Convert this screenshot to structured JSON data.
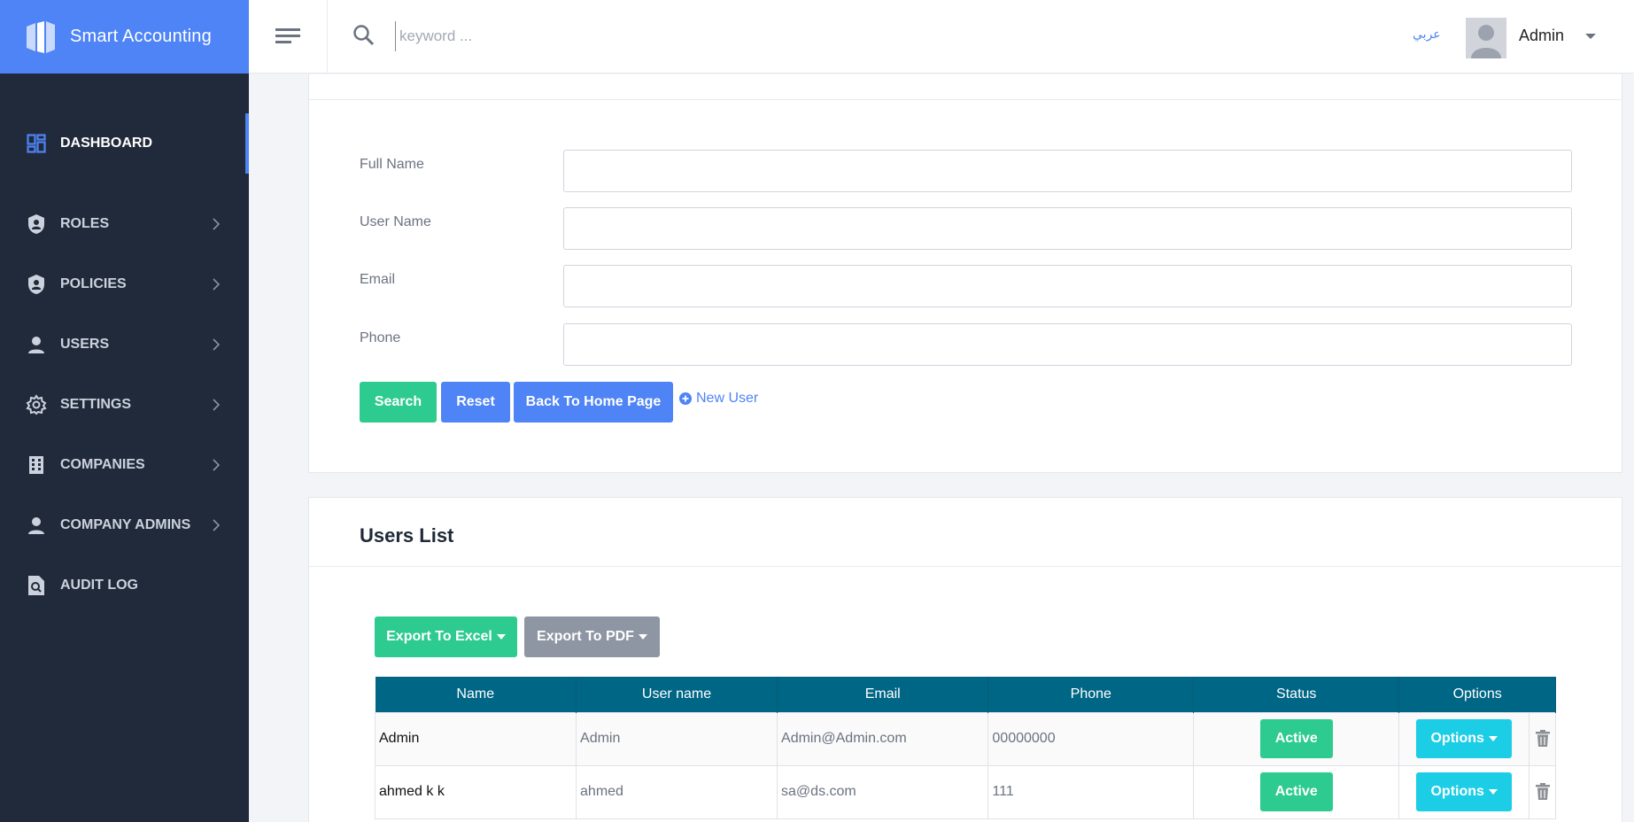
{
  "brand": {
    "title": "Smart Accounting"
  },
  "sidebar": {
    "items": [
      {
        "label": "DASHBOARD",
        "icon": "dashboard-icon",
        "active": true
      },
      {
        "label": "ROLES",
        "icon": "shield-icon"
      },
      {
        "label": "POLICIES",
        "icon": "shield-icon"
      },
      {
        "label": "USERS",
        "icon": "user-icon"
      },
      {
        "label": "SETTINGS",
        "icon": "gear-icon"
      },
      {
        "label": "COMPANIES",
        "icon": "building-icon"
      },
      {
        "label": "COMPANY ADMINS",
        "icon": "user-icon"
      },
      {
        "label": "AUDIT LOG",
        "icon": "audit-icon"
      }
    ]
  },
  "header": {
    "search_placeholder": "keyword ...",
    "language": "عربي",
    "user_name": "Admin"
  },
  "filter": {
    "full_name_label": "Full Name",
    "user_name_label": "User Name",
    "email_label": "Email",
    "phone_label": "Phone",
    "search_button": "Search",
    "reset_button": "Reset",
    "home_button": "Back To Home Page",
    "new_user_link": "New User"
  },
  "users_list": {
    "title": "Users List",
    "export_excel": "Export To Excel",
    "export_pdf": "Export To PDF",
    "columns": [
      "Name",
      "User name",
      "Email",
      "Phone",
      "Status",
      "Options"
    ],
    "rows": [
      {
        "name": "Admin",
        "username": "Admin",
        "email": "Admin@Admin.com",
        "phone": "00000000",
        "status": "Active",
        "options": "Options"
      },
      {
        "name": "ahmed k k",
        "username": "ahmed",
        "email": "sa@ds.com",
        "phone": "111",
        "status": "Active",
        "options": "Options"
      }
    ]
  },
  "colors": {
    "brand": "#4e84f5",
    "sidebar": "#212a3a",
    "success": "#2dcb8f",
    "table_header": "#006685",
    "info": "#1ccde6"
  }
}
